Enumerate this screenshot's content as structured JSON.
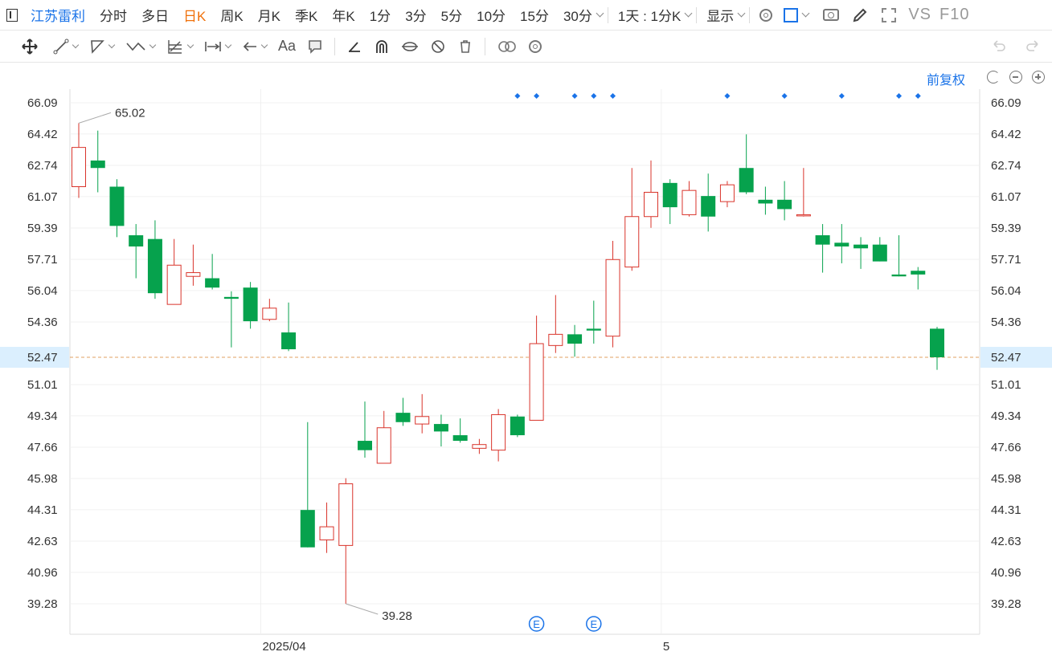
{
  "toolbar": {
    "stock_name": "江苏雷利",
    "periods": [
      "分时",
      "多日",
      "日K",
      "周K",
      "月K",
      "季K",
      "年K",
      "1分",
      "3分",
      "5分",
      "10分",
      "15分",
      "30分"
    ],
    "active_period": "日K",
    "more_label": "1天 : 1分K",
    "display_label": "显示",
    "vs_label": "VS",
    "f10_label": "F10"
  },
  "drawing_tools": [
    {
      "name": "move-icon"
    },
    {
      "name": "line-tool-icon"
    },
    {
      "name": "polyline-tool-icon"
    },
    {
      "name": "wave-tool-icon"
    },
    {
      "name": "fib-tool-icon"
    },
    {
      "name": "measure-tool-icon"
    },
    {
      "name": "arrow-tool-icon"
    },
    {
      "name": "text-tool-icon"
    },
    {
      "name": "comment-tool-icon"
    },
    {
      "name": "pen-tool-icon"
    },
    {
      "name": "magnet-icon"
    },
    {
      "name": "hide-drawings-icon"
    },
    {
      "name": "lock-drawings-icon"
    },
    {
      "name": "delete-drawings-icon"
    },
    {
      "name": "compare-icon"
    },
    {
      "name": "drawing-settings-icon"
    }
  ],
  "text_tool_label": "Aa",
  "adjust_label": "前复权",
  "chart_data": {
    "type": "candlestick",
    "y_ticks": [
      "66.09",
      "64.42",
      "62.74",
      "61.07",
      "59.39",
      "57.71",
      "56.04",
      "54.36",
      "52.47",
      "51.01",
      "49.34",
      "47.66",
      "45.98",
      "44.31",
      "42.63",
      "40.96",
      "39.28"
    ],
    "ylim": [
      39.28,
      66.09
    ],
    "x_ticks": [
      "2025/04",
      "5"
    ],
    "current_price": "52.47",
    "max_label": "65.02",
    "min_label": "39.28",
    "event_label": "E",
    "colors": {
      "up": "#d9342b",
      "down": "#06a24d",
      "accent": "#1a73e8",
      "price_line": "#e0a060"
    },
    "candles": [
      {
        "o": 61.6,
        "h": 65.0,
        "l": 61.0,
        "c": 63.7
      },
      {
        "o": 63.0,
        "h": 64.6,
        "l": 61.3,
        "c": 62.6
      },
      {
        "o": 61.6,
        "h": 62.0,
        "l": 58.9,
        "c": 59.5
      },
      {
        "o": 59.0,
        "h": 59.6,
        "l": 56.7,
        "c": 58.4
      },
      {
        "o": 58.8,
        "h": 59.8,
        "l": 55.6,
        "c": 55.9
      },
      {
        "o": 55.3,
        "h": 58.8,
        "l": 55.3,
        "c": 57.4
      },
      {
        "o": 56.8,
        "h": 58.5,
        "l": 56.3,
        "c": 57.0
      },
      {
        "o": 56.7,
        "h": 58.0,
        "l": 56.1,
        "c": 56.2
      },
      {
        "o": 55.7,
        "h": 56.0,
        "l": 53.0,
        "c": 55.6
      },
      {
        "o": 56.2,
        "h": 56.5,
        "l": 54.0,
        "c": 54.4
      },
      {
        "o": 54.5,
        "h": 55.6,
        "l": 54.4,
        "c": 55.1
      },
      {
        "o": 53.8,
        "h": 55.4,
        "l": 52.8,
        "c": 52.9
      },
      {
        "o": 44.3,
        "h": 49.0,
        "l": 42.3,
        "c": 42.3
      },
      {
        "o": 42.7,
        "h": 44.7,
        "l": 42.0,
        "c": 43.4
      },
      {
        "o": 42.4,
        "h": 46.0,
        "l": 39.28,
        "c": 45.7
      },
      {
        "o": 48.0,
        "h": 50.1,
        "l": 47.1,
        "c": 47.5
      },
      {
        "o": 46.8,
        "h": 49.6,
        "l": 46.8,
        "c": 48.7
      },
      {
        "o": 49.5,
        "h": 50.3,
        "l": 48.8,
        "c": 49.0
      },
      {
        "o": 48.9,
        "h": 50.5,
        "l": 48.4,
        "c": 49.3
      },
      {
        "o": 48.9,
        "h": 49.4,
        "l": 47.7,
        "c": 48.5
      },
      {
        "o": 48.3,
        "h": 49.2,
        "l": 47.9,
        "c": 48.0
      },
      {
        "o": 47.6,
        "h": 48.1,
        "l": 47.3,
        "c": 47.8
      },
      {
        "o": 47.5,
        "h": 49.7,
        "l": 46.9,
        "c": 49.4
      },
      {
        "o": 49.3,
        "h": 49.4,
        "l": 48.2,
        "c": 48.3
      },
      {
        "o": 49.1,
        "h": 54.7,
        "l": 49.1,
        "c": 53.2
      },
      {
        "o": 53.1,
        "h": 55.8,
        "l": 52.7,
        "c": 53.7
      },
      {
        "o": 53.7,
        "h": 54.2,
        "l": 52.5,
        "c": 53.2
      },
      {
        "o": 54.0,
        "h": 55.5,
        "l": 53.2,
        "c": 53.9
      },
      {
        "o": 53.6,
        "h": 58.7,
        "l": 53.0,
        "c": 57.7
      },
      {
        "o": 57.3,
        "h": 62.6,
        "l": 57.1,
        "c": 60.0
      },
      {
        "o": 60.0,
        "h": 63.0,
        "l": 59.4,
        "c": 61.3
      },
      {
        "o": 61.8,
        "h": 62.0,
        "l": 59.6,
        "c": 60.5
      },
      {
        "o": 60.1,
        "h": 61.9,
        "l": 60.0,
        "c": 61.4
      },
      {
        "o": 61.1,
        "h": 62.3,
        "l": 59.2,
        "c": 60.0
      },
      {
        "o": 60.8,
        "h": 61.9,
        "l": 60.5,
        "c": 61.7
      },
      {
        "o": 62.6,
        "h": 64.4,
        "l": 61.2,
        "c": 61.3
      },
      {
        "o": 60.9,
        "h": 61.6,
        "l": 60.1,
        "c": 60.7
      },
      {
        "o": 60.9,
        "h": 61.9,
        "l": 59.8,
        "c": 60.4
      },
      {
        "o": 60.1,
        "h": 62.6,
        "l": 60.0,
        "c": 60.1
      },
      {
        "o": 59.0,
        "h": 59.6,
        "l": 57.0,
        "c": 58.5
      },
      {
        "o": 58.6,
        "h": 59.6,
        "l": 57.5,
        "c": 58.4
      },
      {
        "o": 58.5,
        "h": 58.9,
        "l": 57.2,
        "c": 58.3
      },
      {
        "o": 58.5,
        "h": 58.9,
        "l": 57.6,
        "c": 57.6
      },
      {
        "o": 56.9,
        "h": 59.0,
        "l": 56.8,
        "c": 56.8
      },
      {
        "o": 57.1,
        "h": 57.3,
        "l": 56.1,
        "c": 56.9
      },
      {
        "o": 54.0,
        "h": 54.1,
        "l": 51.8,
        "c": 52.47
      }
    ],
    "marker_dots": [
      23,
      24,
      26,
      27,
      28,
      34,
      37,
      40,
      43,
      44
    ],
    "event_candles": [
      24,
      27
    ],
    "x_tick_candles": [
      9,
      30
    ]
  }
}
